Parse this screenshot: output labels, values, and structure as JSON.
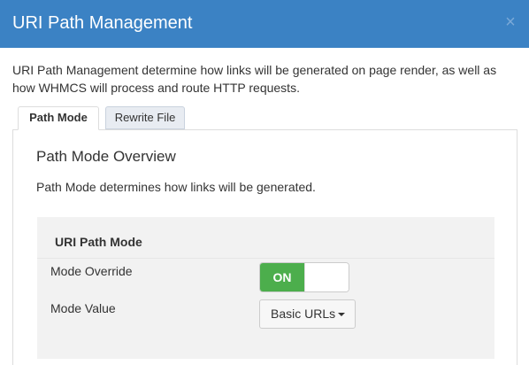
{
  "modal": {
    "title": "URI Path Management",
    "close_label": "×"
  },
  "intro": {
    "text": "URI Path Management determine how links will be generated on page render, as well as how WHMCS will process and route HTTP requests."
  },
  "tabs": [
    {
      "label": "Path Mode",
      "active": true
    },
    {
      "label": "Rewrite File",
      "active": false
    }
  ],
  "overview": {
    "title": "Path Mode Overview",
    "description": "Path Mode determines how links will be generated."
  },
  "mode_settings": {
    "heading": "URI Path Mode",
    "override_label": "Mode Override",
    "override_toggle": {
      "state_label": "ON",
      "value": true
    },
    "value_label": "Mode Value",
    "value_select": {
      "selected": "Basic URLs"
    }
  },
  "colors": {
    "header": "#3b82c4",
    "toggle_on": "#4cae4c",
    "inactive_tab": "#e8ecf2",
    "mode_box": "#f2f2f2"
  },
  "icons": {
    "close": "close-icon",
    "dropdown": "caret-down-icon"
  }
}
